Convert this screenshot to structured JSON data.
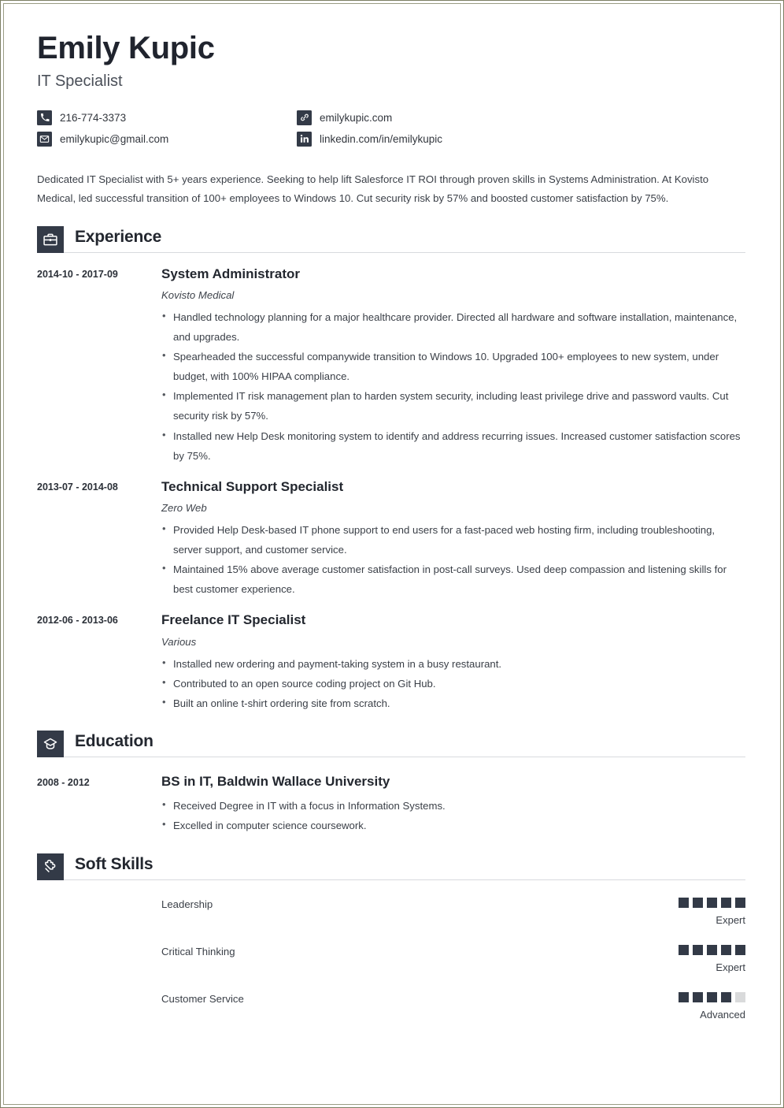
{
  "header": {
    "name": "Emily Kupic",
    "job_title": "IT Specialist",
    "contacts": [
      {
        "icon": "phone-icon",
        "value": "216-774-3373"
      },
      {
        "icon": "link-icon",
        "value": "emilykupic.com"
      },
      {
        "icon": "email-icon",
        "value": "emilykupic@gmail.com"
      },
      {
        "icon": "linkedin-icon",
        "value": "linkedin.com/in/emilykupic"
      }
    ]
  },
  "summary": "Dedicated IT Specialist with 5+ years experience. Seeking to help lift Salesforce IT ROI through proven skills in Systems Administration. At Kovisto Medical, led successful transition of 100+ employees to Windows 10. Cut security risk by 57% and boosted customer satisfaction by 75%.",
  "sections": {
    "experience": {
      "title": "Experience",
      "icon": "briefcase-icon",
      "entries": [
        {
          "date": "2014-10 - 2017-09",
          "role": "System Administrator",
          "org": "Kovisto Medical",
          "bullets": [
            "Handled technology planning for a major healthcare provider. Directed all hardware and software installation, maintenance, and upgrades.",
            "Spearheaded the successful companywide transition to Windows 10. Upgraded 100+ employees to new system, under budget, with 100% HIPAA compliance.",
            "Implemented IT risk management plan to harden system security, including least privilege drive and password vaults. Cut security risk by 57%.",
            "Installed new Help Desk monitoring system to identify and address recurring issues. Increased customer satisfaction scores by 75%."
          ]
        },
        {
          "date": "2013-07 - 2014-08",
          "role": "Technical Support Specialist",
          "org": "Zero Web",
          "bullets": [
            "Provided Help Desk-based IT phone support to end users for a fast-paced web hosting firm, including troubleshooting, server support, and customer service.",
            "Maintained 15% above average customer satisfaction in post-call surveys. Used deep compassion and listening skills for best customer experience."
          ]
        },
        {
          "date": "2012-06 - 2013-06",
          "role": "Freelance IT Specialist",
          "org": "Various",
          "bullets": [
            "Installed new ordering and payment-taking system in a busy restaurant.",
            "Contributed to an open source coding project on Git Hub.",
            "Built an online t-shirt ordering site from scratch."
          ]
        }
      ]
    },
    "education": {
      "title": "Education",
      "icon": "graduation-cap-icon",
      "entries": [
        {
          "date": "2008 - 2012",
          "degree": "BS in IT, Baldwin Wallace University",
          "bullets": [
            "Received Degree in IT with a focus in Information Systems.",
            "Excelled in computer science coursework."
          ]
        }
      ]
    },
    "soft_skills": {
      "title": "Soft Skills",
      "icon": "puzzle-piece-icon",
      "max_rating": 5,
      "items": [
        {
          "name": "Leadership",
          "rating": 5,
          "level": "Expert"
        },
        {
          "name": "Critical Thinking",
          "rating": 5,
          "level": "Expert"
        },
        {
          "name": "Customer Service",
          "rating": 4,
          "level": "Advanced"
        }
      ]
    }
  },
  "colors": {
    "accent_dark": "#333a47",
    "text_dark": "#23272f",
    "meter_off": "#d9dadb",
    "page_border": "#7d7f63"
  }
}
